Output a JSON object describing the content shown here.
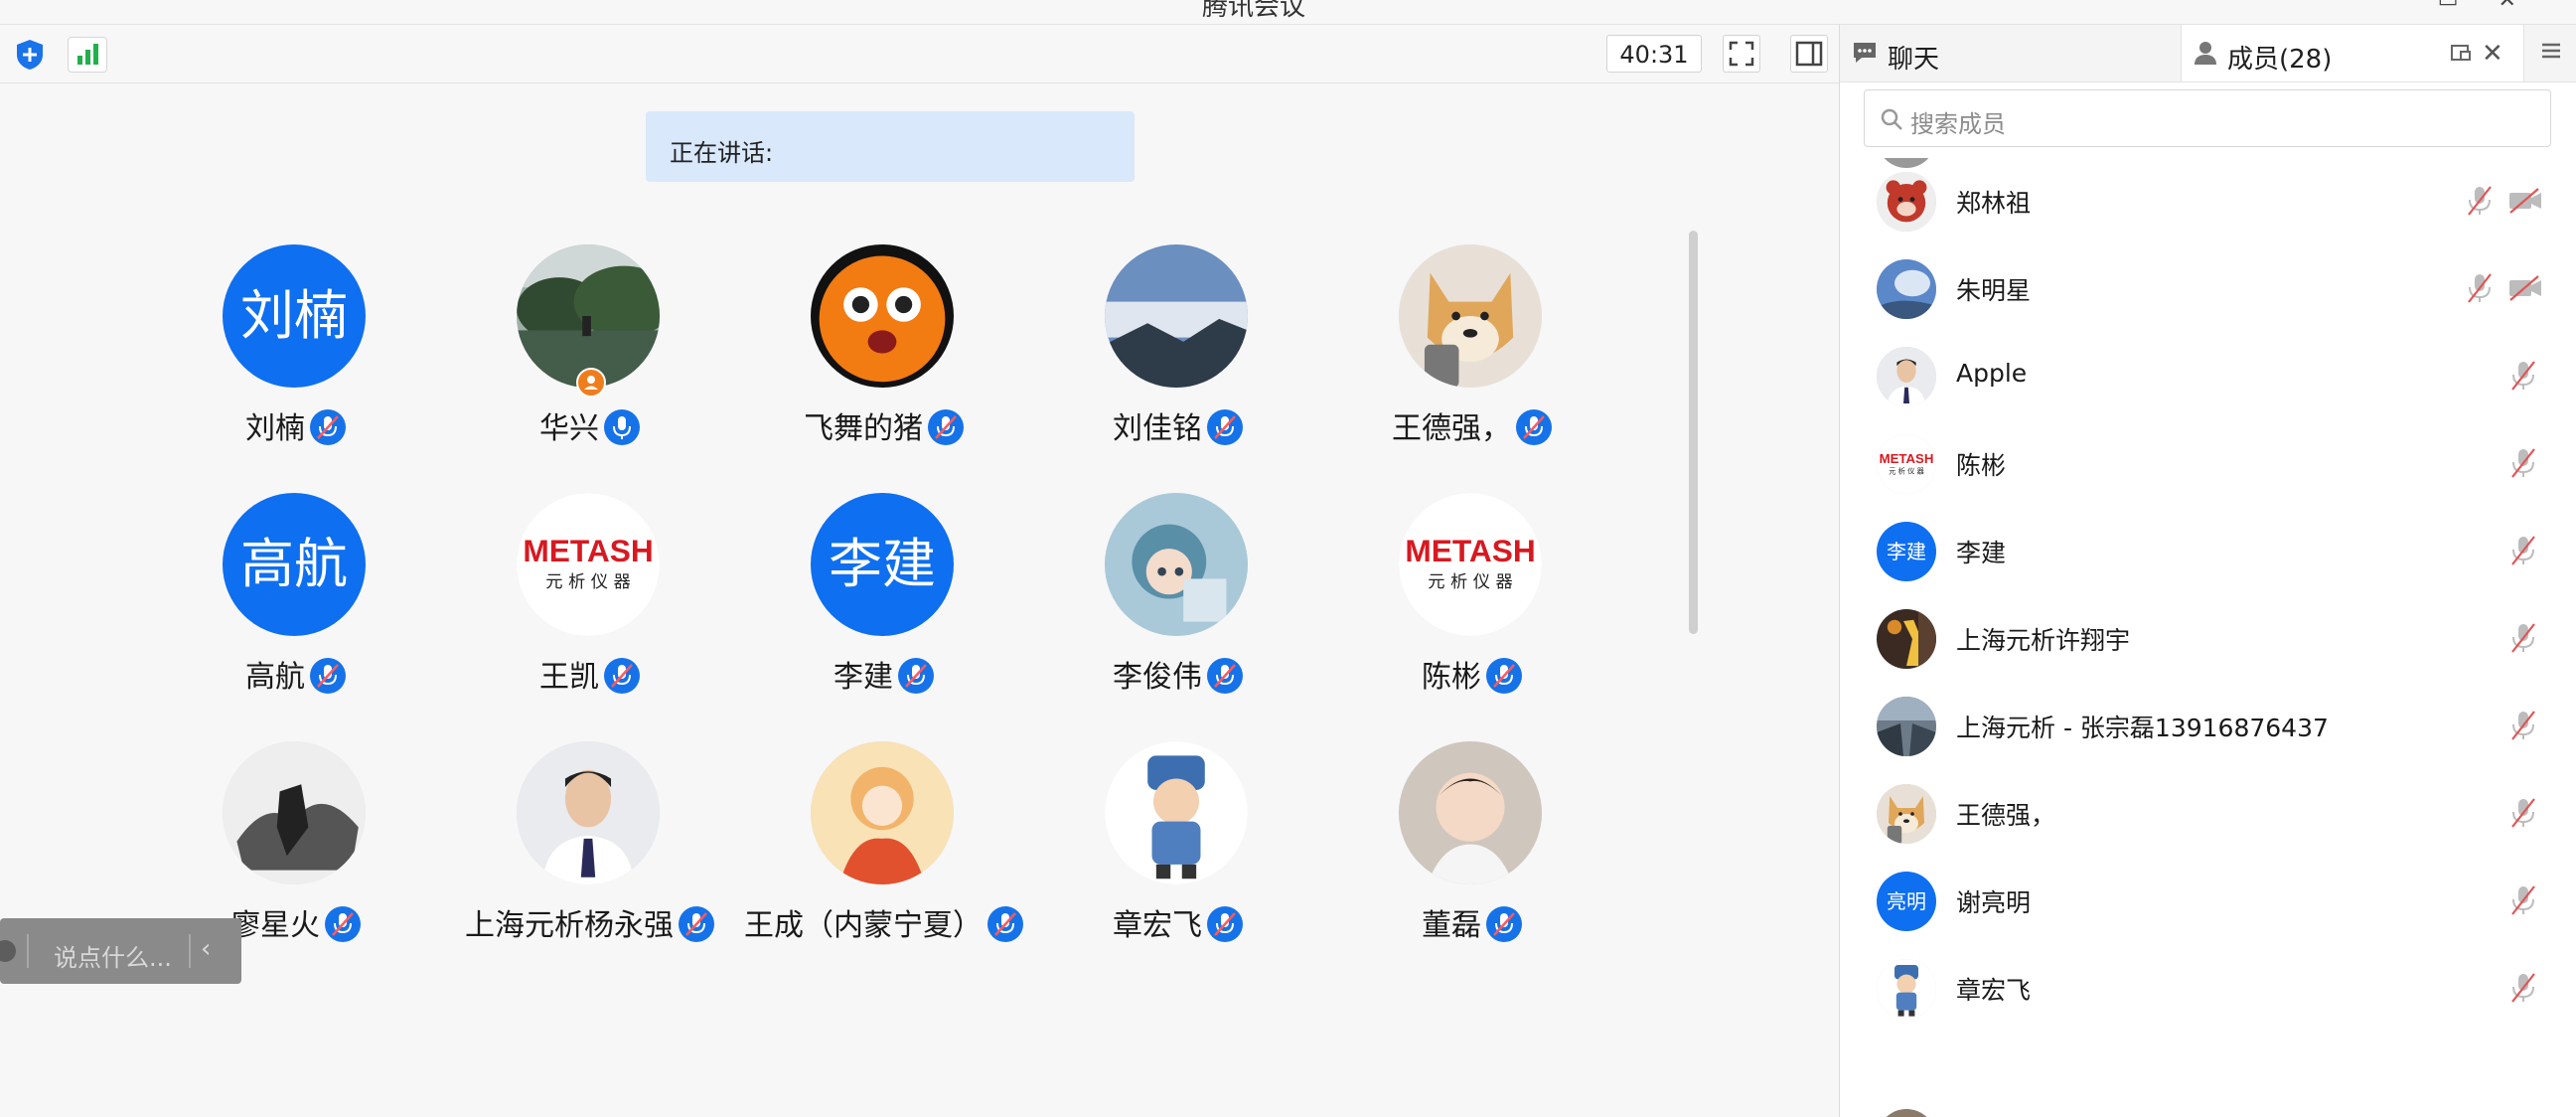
{
  "window": {
    "title": "腾讯会议"
  },
  "toolbar": {
    "timer": "40:31"
  },
  "speaking": {
    "label": "正在讲话:"
  },
  "participants": [
    {
      "name": "刘楠",
      "avatar_text": "刘楠",
      "avatar": "blue-initials"
    },
    {
      "name": "华兴",
      "avatar": "landscape-photo"
    },
    {
      "name": "飞舞的猪",
      "avatar": "orange-cartoon"
    },
    {
      "name": "刘佳铭",
      "avatar": "mountain-photo"
    },
    {
      "name": "王德强，",
      "avatar": "shiba-dog"
    },
    {
      "name": "高航",
      "avatar_text": "高航",
      "avatar": "blue-initials"
    },
    {
      "name": "王凯",
      "avatar": "metash-logo"
    },
    {
      "name": "李建",
      "avatar_text": "李建",
      "avatar": "blue-initials"
    },
    {
      "name": "李俊伟",
      "avatar": "anime-girl"
    },
    {
      "name": "陈彬",
      "avatar": "metash-logo"
    },
    {
      "name": "廖星火",
      "avatar": "soldier-ink"
    },
    {
      "name": "上海元析杨永强",
      "avatar": "man-portrait"
    },
    {
      "name": "王成（内蒙宁夏）",
      "avatar": "anime-illustration"
    },
    {
      "name": "章宏飞",
      "avatar": "cartoon-soldier"
    },
    {
      "name": "董磊",
      "avatar": "baby-photo"
    }
  ],
  "chat_input": {
    "placeholder": "说点什么..."
  },
  "panel": {
    "tab_chat": "聊天",
    "tab_members": "成员(28)",
    "search_placeholder": "搜索成员",
    "logo_text": "METASH",
    "logo_sub": "元 析 仪 器",
    "members": [
      {
        "name": "郑林祖",
        "avatar": "red-bear",
        "cam_off": true
      },
      {
        "name": "朱明星",
        "avatar": "blue-sky",
        "cam_off": true
      },
      {
        "name": "Apple",
        "avatar": "man-portrait"
      },
      {
        "name": "陈彬",
        "avatar": "metash-logo"
      },
      {
        "name": "李建",
        "avatar_text": "李建",
        "avatar": "blue-initials"
      },
      {
        "name": "上海元析许翔宇",
        "avatar": "basketball"
      },
      {
        "name": "上海元析 - 张宗磊13916876437",
        "avatar": "street-photo"
      },
      {
        "name": "王德强，",
        "avatar": "shiba-dog"
      },
      {
        "name": "谢亮明",
        "avatar_text": "亮明",
        "avatar": "blue-initials"
      },
      {
        "name": "章宏飞",
        "avatar": "cartoon-soldier"
      }
    ]
  },
  "colors": {
    "accent": "#0e6ff0",
    "speaking_bg": "#d9e8fb",
    "muted_red": "#e05555"
  }
}
